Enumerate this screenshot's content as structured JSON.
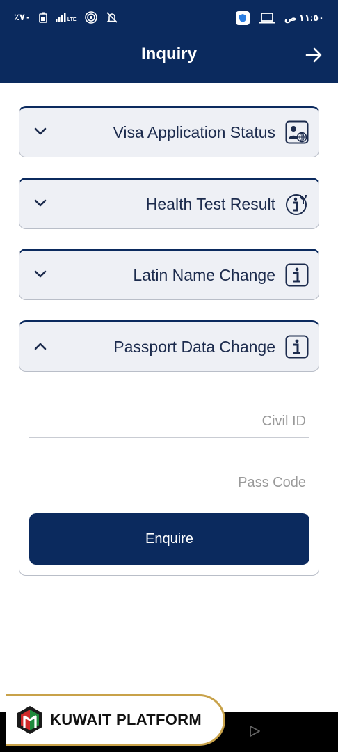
{
  "status_bar": {
    "battery": "٪٧٠",
    "time": "١١:٥٠ ص",
    "signal": "LTE"
  },
  "header": {
    "title": "Inquiry"
  },
  "accordions": [
    {
      "label": "Visa Application Status",
      "icon": "visa-globe-icon",
      "expanded": false
    },
    {
      "label": "Health Test Result",
      "icon": "stethoscope-info-icon",
      "expanded": false
    },
    {
      "label": "Latin Name Change",
      "icon": "info-icon",
      "expanded": false
    },
    {
      "label": "Passport Data Change",
      "icon": "info-icon",
      "expanded": true
    }
  ],
  "form": {
    "civil_id_placeholder": "Civil ID",
    "pass_code_placeholder": "Pass Code",
    "enquire_label": "Enquire"
  },
  "branding": {
    "text": "KUWAIT PLATFORM"
  },
  "colors": {
    "primary": "#0b2a5e",
    "panel_bg": "#eef0f5",
    "gold": "#c8a24a"
  }
}
